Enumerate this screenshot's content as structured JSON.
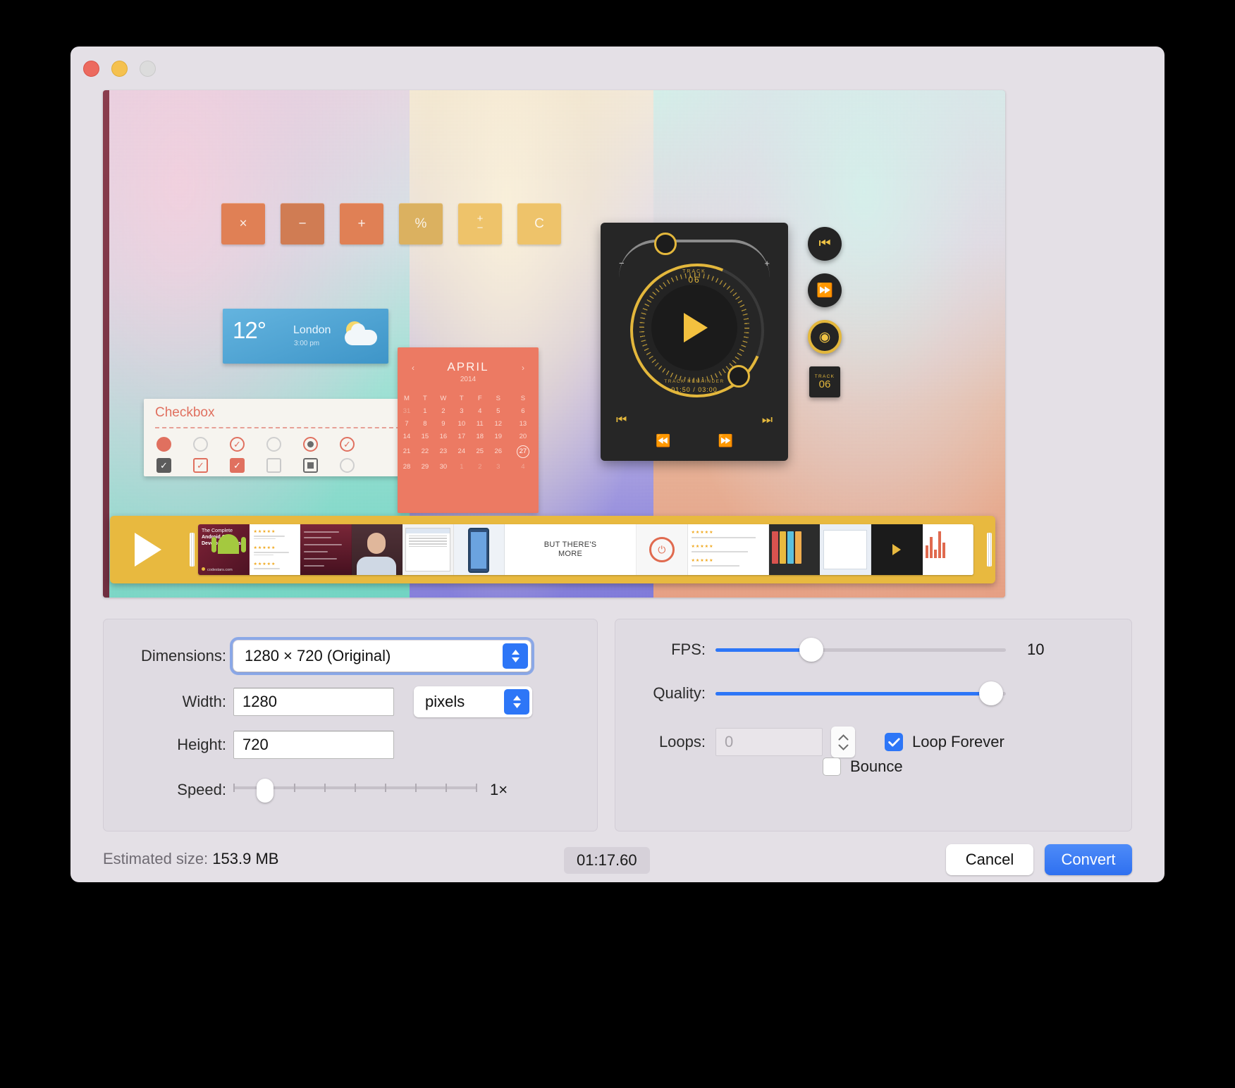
{
  "window": {
    "traffic_lights": [
      "close",
      "minimize",
      "zoom"
    ]
  },
  "preview": {
    "calculator_keys": [
      "×",
      "−",
      "+",
      "%",
      "+/−",
      "C"
    ],
    "weather": {
      "temp": "12°",
      "city": "London",
      "time": "3:00 pm"
    },
    "checkbox_panel": {
      "title": "Checkbox"
    },
    "calendar": {
      "month": "APRIL",
      "year": "2014",
      "weekdays": [
        "M",
        "T",
        "W",
        "T",
        "F",
        "S",
        "S"
      ],
      "weeks": [
        [
          "31",
          "1",
          "2",
          "3",
          "4",
          "5",
          "6"
        ],
        [
          "7",
          "8",
          "9",
          "10",
          "11",
          "12",
          "13"
        ],
        [
          "14",
          "15",
          "16",
          "17",
          "18",
          "19",
          "20"
        ],
        [
          "21",
          "22",
          "23",
          "24",
          "25",
          "26",
          "27"
        ],
        [
          "28",
          "29",
          "30",
          "1",
          "2",
          "3",
          "4"
        ]
      ],
      "selected_day": "27",
      "prev_arrow": "‹",
      "next_arrow": "›"
    },
    "dj_player": {
      "track_label": "TRACK",
      "track_number": "06",
      "remainder_label": "TRACK REMAINDER",
      "remainder_value": "01:50 / 03:00",
      "minus": "−",
      "plus": "+",
      "transport": [
        "⏮",
        "⏭",
        "⏪",
        "⏩"
      ]
    },
    "side_buttons": {
      "prev": "⏮",
      "fast_forward": "⏩",
      "track_label": "TRACK",
      "track_number": "06"
    },
    "filmstrip": {
      "play_icon": "play-triangle",
      "frames": [
        {
          "kind": "course-title",
          "line1": "The Complete",
          "line2": "Android O Developer Course",
          "url": "codestars.com"
        },
        {
          "kind": "reviews"
        },
        {
          "kind": "text-slide"
        },
        {
          "kind": "presenter"
        },
        {
          "kind": "screen-recording"
        },
        {
          "kind": "phone-mockup"
        },
        {
          "kind": "headline",
          "text": "BUT THERE'S\nMORE"
        },
        {
          "kind": "power-icon"
        },
        {
          "kind": "reviews-2"
        },
        {
          "kind": "books"
        },
        {
          "kind": "ui-card"
        },
        {
          "kind": "video-dark"
        },
        {
          "kind": "chart"
        }
      ]
    }
  },
  "settings": {
    "dimensions": {
      "label": "Dimensions:",
      "value": "1280 × 720 (Original)"
    },
    "width": {
      "label": "Width:",
      "value": "1280"
    },
    "height": {
      "label": "Height:",
      "value": "720"
    },
    "units": {
      "value": "pixels"
    },
    "speed": {
      "label": "Speed:",
      "value": "1×",
      "position_percent": 13,
      "ticks": 9
    },
    "fps": {
      "label": "FPS:",
      "value": "10",
      "fill_percent": 33
    },
    "quality": {
      "label": "Quality:",
      "value": "",
      "fill_percent": 95
    },
    "loops": {
      "label": "Loops:",
      "placeholder": "0",
      "value": "",
      "disabled": true
    },
    "loop_forever": {
      "label": "Loop Forever",
      "checked": true,
      "check_glyph": "✓"
    },
    "bounce": {
      "label": "Bounce",
      "checked": false
    }
  },
  "footer": {
    "estimated_size_label": "Estimated size:",
    "estimated_size_value": "153.9 MB",
    "duration": "01:17.60",
    "cancel_label": "Cancel",
    "convert_label": "Convert"
  },
  "colors": {
    "accent": "#2d76f7",
    "window_bg": "#e4e0e6",
    "group_bg": "#dfdbe2",
    "traffic_close": "#ec6a5f",
    "traffic_min": "#f5c14f",
    "traffic_zoom": "#dcdcdc"
  }
}
